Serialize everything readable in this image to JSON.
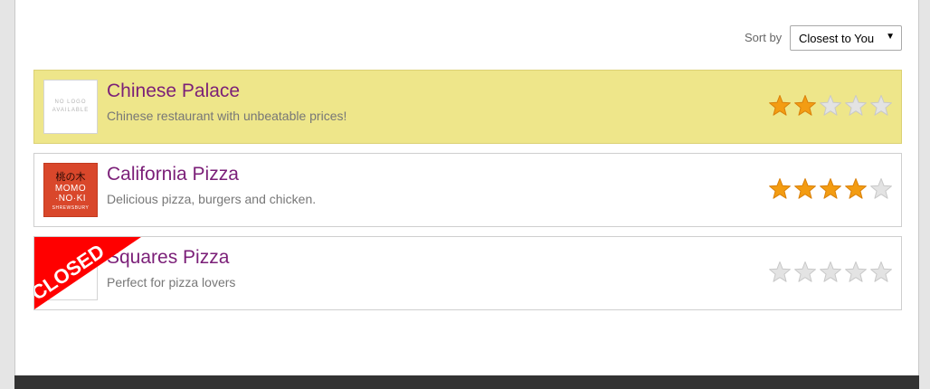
{
  "sort": {
    "label": "Sort by",
    "selected": "Closest to You"
  },
  "restaurants": [
    {
      "name": "Chinese Palace",
      "description": "Chinese restaurant with unbeatable prices!",
      "logo_text": [
        "NO LOGO",
        "AVAILABLE"
      ],
      "rating": 2,
      "max_rating": 5,
      "highlighted": true
    },
    {
      "name": "California Pizza",
      "description": "Delicious pizza, burgers and chicken.",
      "logo_text": [
        "桃の木",
        "MOMO",
        "·NO·KI",
        "SHREWSBURY"
      ],
      "rating": 4,
      "max_rating": 5,
      "highlighted": false
    },
    {
      "name": "Squares Pizza",
      "description": "Perfect for pizza lovers",
      "rating": 0,
      "max_rating": 5,
      "badge": "CLOSED",
      "highlighted": false
    }
  ],
  "colors": {
    "highlight": "#eee68a",
    "name": "#7b1f78",
    "star_filled": "#f39c12",
    "star_empty": "#e3e3e3",
    "closed_badge": "#ff0000",
    "footer": "#333333"
  }
}
